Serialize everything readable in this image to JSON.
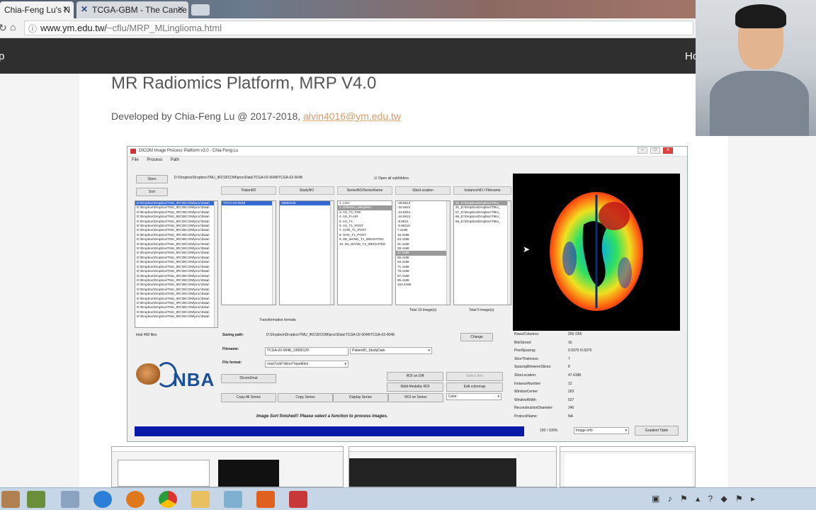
{
  "browser": {
    "tabs": [
      {
        "label": "Chia-Feng Lu's N"
      },
      {
        "label": "TCGA-GBM - The Cance"
      }
    ],
    "url_host": "www.ym.edu.tw/",
    "url_path": "~cflu/MRP_MLinglioma.html",
    "nav_right": "Ho"
  },
  "page": {
    "title": "MR Radiomics Platform, MRP V4.0",
    "subtitle_prefix": "Developed by Chia-Feng Lu @ 2017-2018, ",
    "email": "alvin4016@ym.edu.tw"
  },
  "app": {
    "window_title": "DICOM Image Process Platform v3.0 - Chia-Feng Lu",
    "menu": [
      "File",
      "Process",
      "Path"
    ],
    "open_label": "Open",
    "sort_label": "Sort",
    "path_value": "D:\\Dropbox\\Dropbox\\TMU_IRC\\DICOM\\proc\\Data\\TCGA-02-0048\\TCGA-02-0048",
    "open_all_label": "Open all subfolders",
    "columns": [
      "PatientID",
      "StudyNO",
      "SeriesNO/SeriesName",
      "SliceLocation",
      "InstanceNO / Filename"
    ],
    "files_rows": [
      "D:\\Dropbox\\Dropbox\\TMU_IRC\\DICOM\\proc\\Data\\",
      "D:\\Dropbox\\Dropbox\\TMU_IRC\\DICOM\\proc\\Data\\",
      "D:\\Dropbox\\Dropbox\\TMU_IRC\\DICOM\\proc\\Data\\",
      "D:\\Dropbox\\Dropbox\\TMU_IRC\\DICOM\\proc\\Data\\",
      "D:\\Dropbox\\Dropbox\\TMU_IRC\\DICOM\\proc\\Data\\",
      "D:\\Dropbox\\Dropbox\\TMU_IRC\\DICOM\\proc\\Data\\",
      "D:\\Dropbox\\Dropbox\\TMU_IRC\\DICOM\\proc\\Data\\",
      "D:\\Dropbox\\Dropbox\\TMU_IRC\\DICOM\\proc\\Data\\",
      "D:\\Dropbox\\Dropbox\\TMU_IRC\\DICOM\\proc\\Data\\",
      "D:\\Dropbox\\Dropbox\\TMU_IRC\\DICOM\\proc\\Data\\",
      "D:\\Dropbox\\Dropbox\\TMU_IRC\\DICOM\\proc\\Data\\",
      "D:\\Dropbox\\Dropbox\\TMU_IRC\\DICOM\\proc\\Data\\",
      "D:\\Dropbox\\Dropbox\\TMU_IRC\\DICOM\\proc\\Data\\",
      "D:\\Dropbox\\Dropbox\\TMU_IRC\\DICOM\\proc\\Data\\",
      "D:\\Dropbox\\Dropbox\\TMU_IRC\\DICOM\\proc\\Data\\",
      "D:\\Dropbox\\Dropbox\\TMU_IRC\\DICOM\\proc\\Data\\",
      "D:\\Dropbox\\Dropbox\\TMU_IRC\\DICOM\\proc\\Data\\",
      "D:\\Dropbox\\Dropbox\\TMU_IRC\\DICOM\\proc\\Data\\",
      "D:\\Dropbox\\Dropbox\\TMU_IRC\\DICOM\\proc\\Data\\",
      "D:\\Dropbox\\Dropbox\\TMU_IRC\\DICOM\\proc\\Data\\",
      "D:\\Dropbox\\Dropbox\\TMU_IRC\\DICOM\\proc\\Data\\",
      "D:\\Dropbox\\Dropbox\\TMU_IRC\\DICOM\\proc\\Data\\",
      "D:\\Dropbox\\Dropbox\\TMU_IRC\\DICOM\\proc\\Data\\",
      "D:\\Dropbox\\Dropbox\\TMU_IRC\\DICOM\\proc\\Data\\",
      "D:\\Dropbox\\Dropbox\\TMU_IRC\\DICOM\\proc\\Data\\",
      "D:\\Dropbox\\Dropbox\\TMU_IRC\\DICOM\\proc\\Data\\"
    ],
    "patient_rows": [
      "TCGA-02-0048"
    ],
    "study_rows": [
      "19990129"
    ],
    "series_rows": [
      "1. LOC",
      "2. Diffusion_Weighted",
      "3. AX_T2_FSE",
      "4. AX_FLAIR",
      "5. AX_T1",
      "6. AX_T1_POST",
      "7. COR_T1_POST",
      "8. SAG_T1_POST",
      "9. 3D_WAND_T1_WEIGHTED",
      "10. 2D_WAND_T2_WEIGHTED"
    ],
    "slice_rows": [
      "-40.5812",
      "-32.5812",
      "-24.5812",
      "-16.5812",
      "-8.5812",
      "-0.58116",
      "7.4188",
      "15.4188",
      "23.4188",
      "31.4188",
      "39.4188",
      "47.4188",
      "55.4188",
      "63.4188",
      "71.4188",
      "79.4188",
      "87.4188",
      "95.4188",
      "103.4188"
    ],
    "instance_rows": [
      "32_D:\\Dropbox\\Dropbox\\TMU_",
      "31_D:\\Dropbox\\Dropbox\\TMU_",
      "57_D:\\Dropbox\\Dropbox\\TMU_",
      "69_D:\\Dropbox\\Dropbox\\TMU_",
      "88_D:\\Dropbox\\Dropbox\\TMU_"
    ],
    "total_slices": "Total 19 image(s)",
    "total_instances": "Total 5 image(s)",
    "transformation_formats": "Transformation formats",
    "total_files": "total 499 files",
    "saving_path_label": "Saving path:",
    "saving_path_value": "D:\\Dropbox\\Dropbox\\TMU_IRC\\DICOM\\proc\\Data\\TCGA-02-0048\\TCGA-02-0048",
    "change_label": "Change",
    "filename_label": "Filename:",
    "filename_value": "TCGA-02-0048_19990129",
    "filename_option": "PatientID_StudyDate",
    "fileformat_label": "File format:",
    "fileformat_value": "rows*cols*slices*repetition",
    "dicom2mat_label": "Dicom2mat",
    "roi_on_diff": "ROI on Diff",
    "select_first": "Select first",
    "multi_modality_roi": "Multi-Modality ROI",
    "edit_colormap": "Edit colormap",
    "copy_all_series": "Copy All Series",
    "copy_series": "Copy Series",
    "display_series": "Display Series",
    "roi_on_series": "ROI on Series",
    "color_option": "Color",
    "status": "Image Sort finished!! Please select a function to process images.",
    "progress_text": "100 / 100%",
    "progress": 1.0,
    "image_info_option": "Image Info",
    "gradient_table": "Gradient Table",
    "logo_text": "NBA",
    "info": [
      {
        "k": "Rows/Columns:",
        "v": "256 /256"
      },
      {
        "k": "BitsStored:",
        "v": "16"
      },
      {
        "k": "PixelSpacing:",
        "v": "0.9375 /0.9375"
      },
      {
        "k": "SliceThickness:",
        "v": "7"
      },
      {
        "k": "SpacingBetweenSlices:",
        "v": "8"
      },
      {
        "k": "SliceLocation:",
        "v": "47.4188"
      },
      {
        "k": "InstanceNumber:",
        "v": "12"
      },
      {
        "k": "WindowCenter:",
        "v": "263"
      },
      {
        "k": "WindowWidth:",
        "v": "527"
      },
      {
        "k": "ReconstructionDiameter:",
        "v": "240"
      },
      {
        "k": "ProtocolName:",
        "v": "NA"
      }
    ]
  },
  "colors": {
    "accent_link": "#d99a6c",
    "navbar": "#2f2f2f",
    "progress": "#0a1aa8",
    "selection": "#3569d6"
  }
}
